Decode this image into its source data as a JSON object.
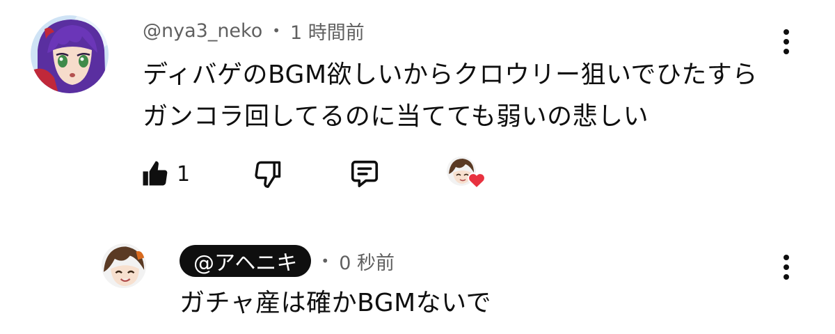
{
  "comment": {
    "author": "@nya3_neko",
    "separator": "•",
    "time": "1 時間前",
    "text_line1": "ディバゲのBGM欲しいからクロウリー狙いでひたすら",
    "text_line2": "ガンコラ回してるのに当てても弱いの悲しい",
    "like_count": "1",
    "avatar_icon": "anime-girl-avatar-icon",
    "creator_heart_icon": "creator-heart-icon"
  },
  "reply": {
    "author": "@アヘニキ",
    "separator": "•",
    "time": "0 秒前",
    "text": "ガチャ産は確かBGMないで",
    "avatar_icon": "anime-boy-avatar-icon"
  },
  "colors": {
    "text": "#0f0f0f",
    "meta": "#606060",
    "heart": "#e8323f",
    "chip_bg": "#0f0f0f",
    "chip_text": "#ffffff"
  }
}
